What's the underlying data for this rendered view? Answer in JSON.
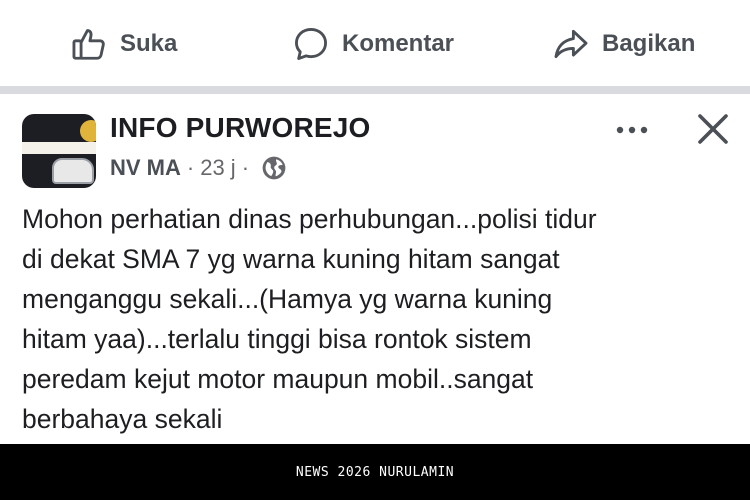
{
  "actions": {
    "like": {
      "label": "Suka",
      "icon": "thumbs-up-icon"
    },
    "comment": {
      "label": "Komentar",
      "icon": "comment-bubble-icon"
    },
    "share": {
      "label": "Bagikan",
      "icon": "share-arrow-icon"
    }
  },
  "post": {
    "page_name": "INFO PURWOREJO",
    "author": "NV MA",
    "separator": "·",
    "time": "23 j",
    "audience_icon": "globe-icon",
    "body_lines": [
      "Mohon perhatian dinas perhubungan...polisi tidur",
      "di dekat SMA 7 yg warna kuning hitam sangat",
      "menganggu sekali...(Hamya yg warna kuning",
      "hitam yaa)...terlalu tinggi bisa rontok sistem",
      "peredam kejut motor maupun mobil..sangat",
      "berbahaya sekali"
    ]
  },
  "watermark": "NEWS 2026 NURULAMIN",
  "colors": {
    "text": "#1c1e21",
    "secondary": "#65676b",
    "divider": "#d8dadf"
  }
}
